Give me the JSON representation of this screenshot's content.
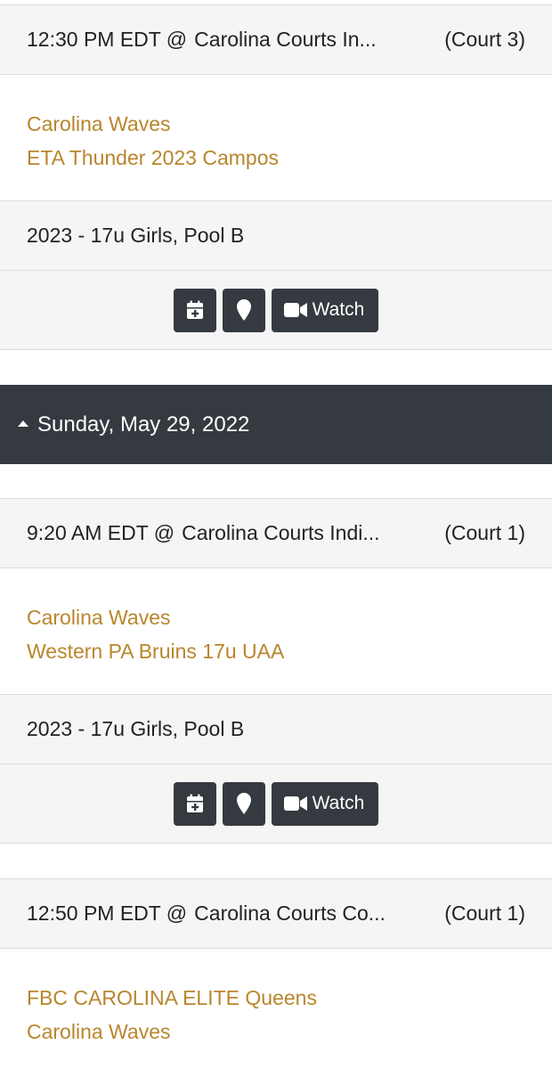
{
  "games": [
    {
      "time": "12:30 PM EDT @",
      "venue": "Carolina Courts In...",
      "court": "(Court 3)",
      "teams": [
        "Carolina Waves",
        "ETA Thunder 2023 Campos"
      ],
      "pool": "2023 - 17u Girls, Pool B",
      "watch_label": "Watch"
    },
    {
      "time": "9:20 AM EDT @",
      "venue": "Carolina Courts Indi...",
      "court": "(Court 1)",
      "teams": [
        "Carolina Waves",
        "Western PA Bruins 17u UAA"
      ],
      "pool": "2023 - 17u Girls, Pool B",
      "watch_label": "Watch"
    },
    {
      "time": "12:50 PM EDT @",
      "venue": "Carolina Courts Co...",
      "court": "(Court 1)",
      "teams": [
        "FBC CAROLINA ELITE Queens",
        "Carolina Waves"
      ]
    }
  ],
  "day_header": {
    "label": "Sunday, May 29, 2022",
    "icon": "caret-up-icon"
  },
  "icons": {
    "calendar": "calendar-plus-icon",
    "location": "map-marker-icon",
    "video": "video-camera-icon"
  },
  "colors": {
    "team_link": "#b8862c",
    "dark_bar": "#343a40",
    "row_grey": "#f5f5f5"
  }
}
